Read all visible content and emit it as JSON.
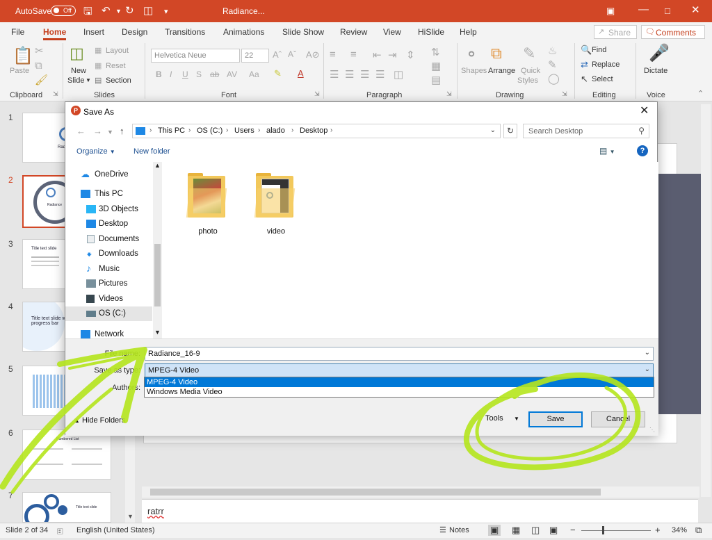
{
  "titlebar": {
    "autosave_label": "AutoSave",
    "autosave_state": "Off",
    "doc_title": "Radiance...",
    "accent": "#d24726"
  },
  "ribbon_tabs": [
    "File",
    "Home",
    "Insert",
    "Design",
    "Transitions",
    "Animations",
    "Slide Show",
    "Review",
    "View",
    "HiSlide",
    "Help"
  ],
  "share_label": "Share",
  "comments_label": "Comments",
  "ribbon": {
    "paste": "Paste",
    "new_slide_1": "New",
    "new_slide_2": "Slide",
    "layout": "Layout",
    "reset": "Reset",
    "section": "Section",
    "font_name": "Helvetica Neue",
    "font_size": "22",
    "shapes": "Shapes",
    "arrange": "Arrange",
    "quick_styles_1": "Quick",
    "quick_styles_2": "Styles",
    "find": "Find",
    "replace": "Replace",
    "select": "Select",
    "dictate": "Dictate",
    "groups": {
      "clipboard": "Clipboard",
      "slides": "Slides",
      "font": "Font",
      "paragraph": "Paragraph",
      "drawing": "Drawing",
      "editing": "Editing",
      "voice": "Voice"
    }
  },
  "thumbnails": [
    {
      "num": "1",
      "text": "Radiance"
    },
    {
      "num": "2",
      "text": "Radiance"
    },
    {
      "num": "3",
      "text": "Title text slide"
    },
    {
      "num": "4",
      "text": "Title text slide with progress bar"
    },
    {
      "num": "5",
      "text": ""
    },
    {
      "num": "6",
      "text": "Numbered List"
    },
    {
      "num": "7",
      "text": "Title text slide"
    }
  ],
  "notes_text": "ratrr",
  "statusbar": {
    "slide_info": "Slide 2 of 34",
    "language": "English (United States)",
    "notes": "Notes",
    "zoom": "34%"
  },
  "dialog": {
    "title": "Save As",
    "breadcrumb": [
      "This PC",
      "OS (C:)",
      "Users",
      "alado",
      "Desktop"
    ],
    "search_placeholder": "Search Desktop",
    "organize": "Organize",
    "new_folder": "New folder",
    "nav_items": [
      {
        "label": "OneDrive",
        "icon": "onedrive-icon"
      },
      {
        "label": "This PC",
        "icon": "computer-icon"
      },
      {
        "label": "3D Objects",
        "icon": "cube-icon"
      },
      {
        "label": "Desktop",
        "icon": "desktop-icon"
      },
      {
        "label": "Documents",
        "icon": "document-icon"
      },
      {
        "label": "Downloads",
        "icon": "download-icon"
      },
      {
        "label": "Music",
        "icon": "music-icon"
      },
      {
        "label": "Pictures",
        "icon": "pictures-icon"
      },
      {
        "label": "Videos",
        "icon": "video-icon"
      },
      {
        "label": "OS (C:)",
        "icon": "drive-icon"
      },
      {
        "label": "Network",
        "icon": "network-icon"
      }
    ],
    "folders": [
      "photo",
      "video"
    ],
    "file_name_label": "File name:",
    "file_name_value": "Radiance_16-9",
    "save_as_type_label": "Save as type:",
    "save_as_type_value": "MPEG-4 Video",
    "authors_label": "Authors:",
    "type_options": [
      "MPEG-4 Video",
      "Windows Media Video"
    ],
    "hide_folders": "Hide Folders",
    "tools": "Tools",
    "save": "Save",
    "cancel": "Cancel"
  },
  "annotation_color": "#b5e61d"
}
